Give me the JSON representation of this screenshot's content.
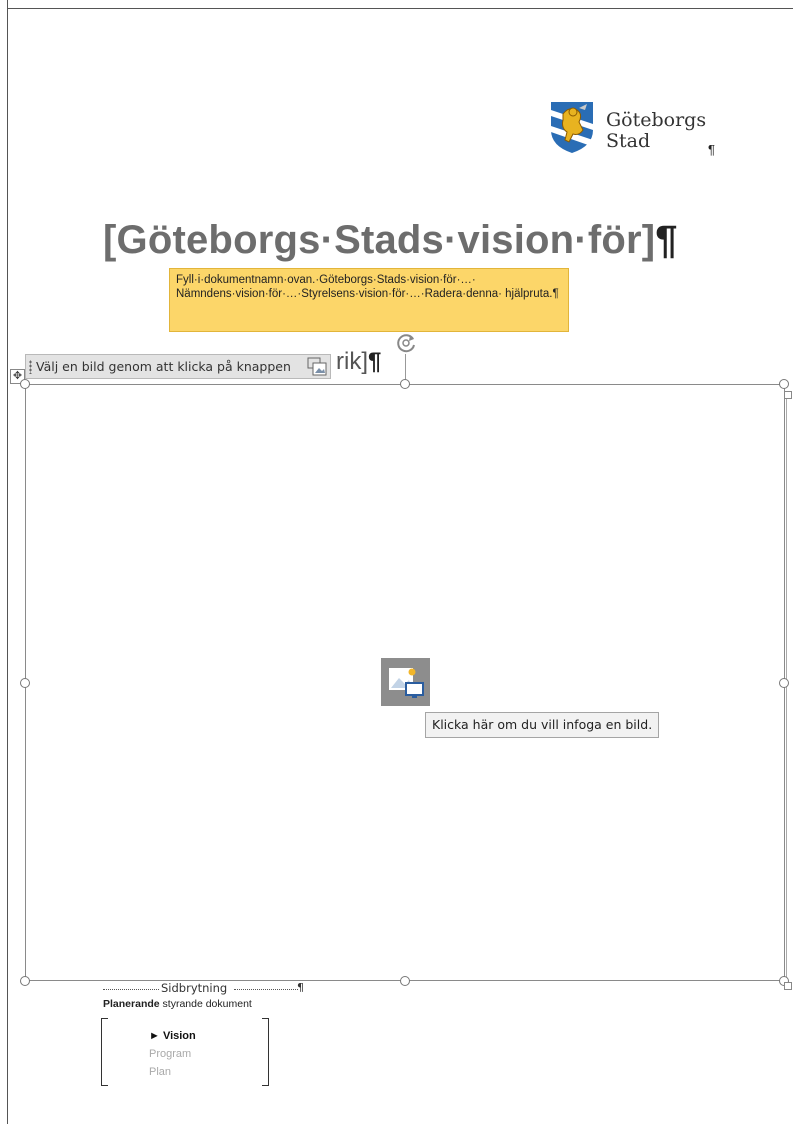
{
  "logo": {
    "line1": "Göteborgs",
    "line2": "Stad",
    "pilcrow": "¶"
  },
  "document": {
    "title": "[Göteborgs·Stads·vision·för]",
    "title_pilcrow": "¶",
    "help_text": "Fyll·i·dokumentnamn·ovan.·Göteborgs·Stads·vision·för·…· Nämndens·vision·för·…·Styrelsens·vision·för·…·Radera·denna· hjälpruta.¶",
    "subtitle_visible_part": "rik]",
    "subtitle_pilcrow": "¶"
  },
  "content_control": {
    "label": "Välj en bild genom att klicka på knappen"
  },
  "picture_placeholder": {
    "tooltip": "Klicka här om du vill infoga en bild."
  },
  "page_break": {
    "label": "Sidbrytning",
    "pilcrow": "¶"
  },
  "doc_type": {
    "bold": "Planerande",
    "rest": " styrande dokument"
  },
  "hierarchy": {
    "items": [
      {
        "label": "► Vision",
        "active": true
      },
      {
        "label": "Program",
        "active": false
      },
      {
        "label": "Plan",
        "active": false
      }
    ]
  },
  "colors": {
    "help_box": "#fcd669",
    "title_gray": "#6d6d6d",
    "logo_blue": "#2a6db5",
    "logo_gold": "#e8b320"
  }
}
